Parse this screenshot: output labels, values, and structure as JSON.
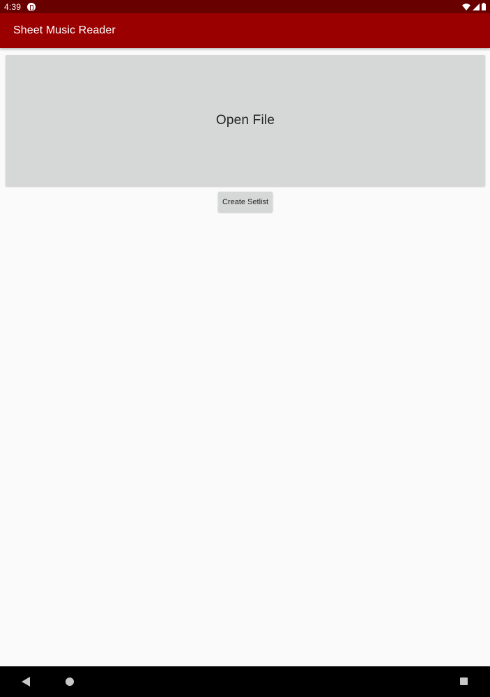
{
  "status_bar": {
    "time": "4:39",
    "icons": [
      "notification-icon",
      "wifi-icon",
      "signal-icon",
      "battery-icon"
    ]
  },
  "app_bar": {
    "title": "Sheet Music Reader",
    "color": "#9b0000"
  },
  "main": {
    "open_file_label": "Open File",
    "create_setlist_label": "Create Setlist"
  },
  "nav_bar": {
    "buttons": [
      "back-icon",
      "home-icon",
      "recents-icon"
    ]
  },
  "colors": {
    "status_bar": "#690000",
    "app_bar": "#9b0000",
    "button_bg": "#d6d7d7",
    "background": "#fafafa"
  }
}
